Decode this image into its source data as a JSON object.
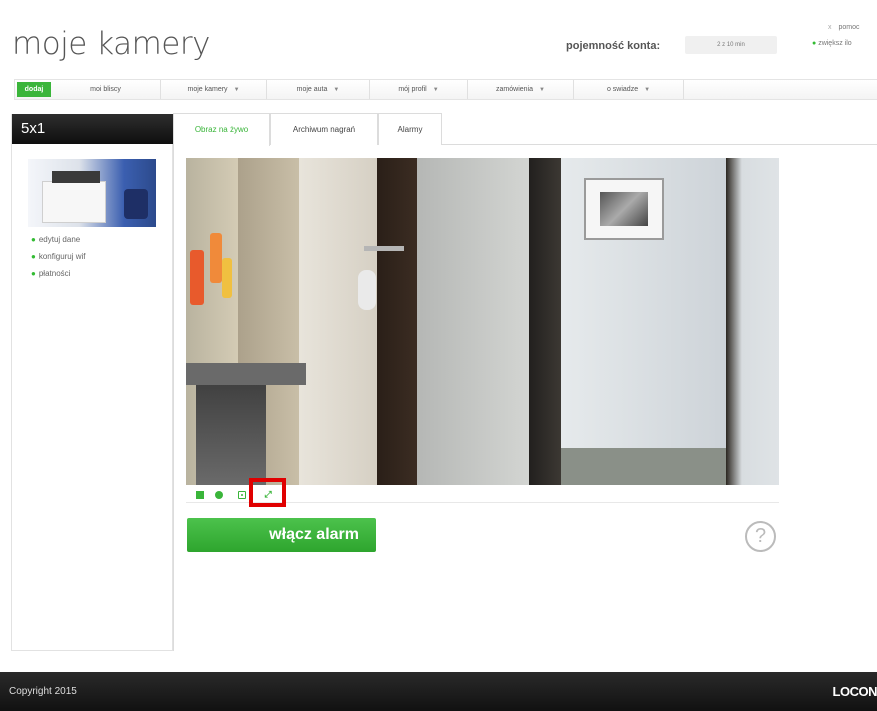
{
  "header": {
    "logo": "moje kamery",
    "capacity_label": "pojemność konta:",
    "capacity_value": "2 z 10 min",
    "help_link": "pomoc",
    "help_close": "x",
    "expand_link": "zwiększ ilo"
  },
  "nav": {
    "items": [
      {
        "label": "dodaj"
      },
      {
        "label": "moi bliscy"
      },
      {
        "label": "moje kamery",
        "arrow": "▼"
      },
      {
        "label": "moje auta",
        "arrow": "▼"
      },
      {
        "label": "mój profil",
        "arrow": "▼"
      },
      {
        "label": "zamówienia",
        "arrow": "▼"
      },
      {
        "label": "o swiadze",
        "arrow": "▼"
      }
    ]
  },
  "sidebar": {
    "title": "5x1",
    "links": [
      "edytuj dane",
      "konfiguruj wif",
      "płatności"
    ],
    "bullet": "●"
  },
  "tabs": [
    {
      "label": "Obraz na żywo",
      "active": true
    },
    {
      "label": "Archiwum nagrań",
      "active": false
    },
    {
      "label": "Alarmy",
      "active": false
    }
  ],
  "controls": {
    "ptz_icon_text": "⤢"
  },
  "alarm_button": "włącz alarm",
  "help_icon": "?",
  "footer": {
    "copyright": "Copyright 2015",
    "brand": "LOCON"
  },
  "colors": {
    "accent": "#3ab53a",
    "highlight": "#e00000",
    "sidebar_header": "#1a1a1a",
    "footer": "#1a1a1a"
  }
}
